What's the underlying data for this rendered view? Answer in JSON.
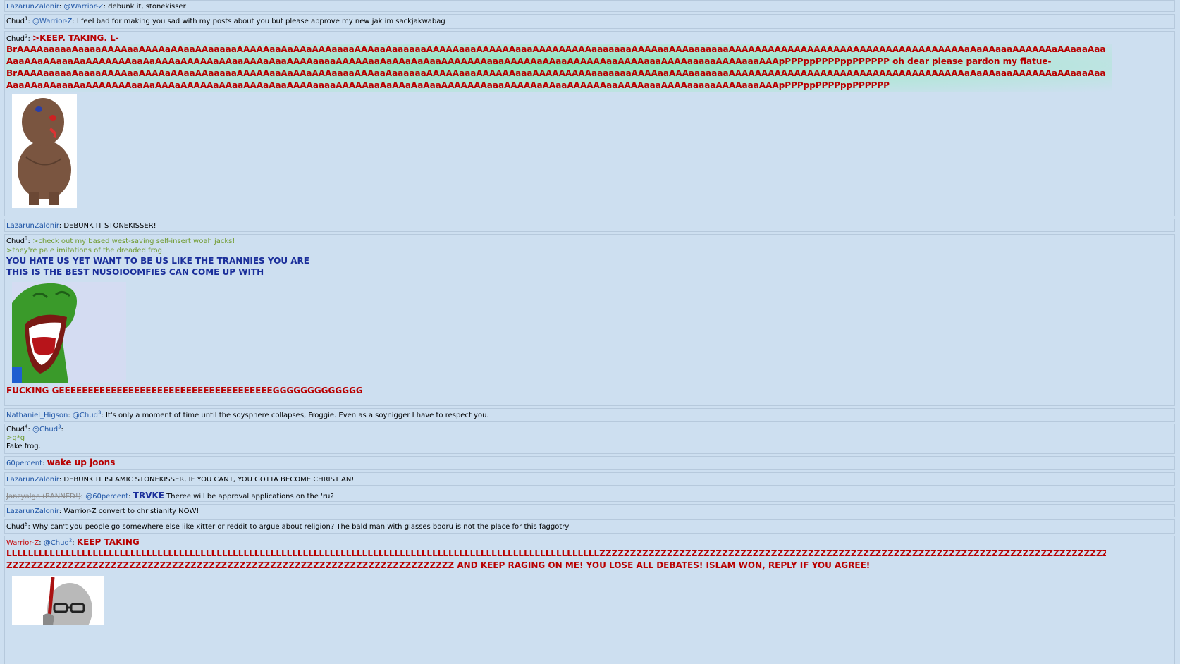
{
  "messages": [
    {
      "user": "LazarunZalonir",
      "mention": "@Warrior-Z",
      "text": ": debunk it, stonekisser"
    },
    {
      "user": "Chud",
      "sup": "1",
      "mention": "@Warrior-Z",
      "text": ": I feel bad for making you sad with my posts about you but please approve my new jak im sackjakwabag"
    },
    {
      "user": "Chud",
      "sup": "2",
      "big_line1": ">KEEP. TAKING. L-",
      "big_line2": "BrAAAAaaaaaAaaaaAAAAaaAAAAaAAaaAAaaaaaAAAAAaaAaAAaAAAaaaaAAAaaAaaaaaaAAAAAaaaAAAAAAaaaAAAAAAAAAaaaaaaaAAAAaaAAAaaaaaaaAAAAAAAAAAAAAAAAAAAAAAAAAAAAAAAAAAAAaAaAAaaaAAAAAAaAAaaaAaaaaaaaAaAAAaaaAAA",
      "big_line3": "AaaAAaAAaaaAaAAAAAAAaaAaAAAaAAAAAaAAaaAAAaAaaAAAAaaaaAAAAAaaAaAAaAaAaaAAAAAAAaaaAAAAAaAAaaAAAAAAaaAAAAaaaAAAAaaaaaAAAAaaaAAApPPPppPPPPppPPPPPP",
      "big_line3_tail": " oh dear please pardon my flatue-",
      "big_line4": "BrAAAAaaaaaAaaaaAAAAaaAAAAaAAaaAAaaaaaAAAAAaaAaAAaAAAaaaaAAAaaAaaaaaaAAAAAaaaAAAAAAaaaAAAAAAAAAaaaaaaaAAAAaaAAAaaaaaaaAAAAAAAAAAAAAAAAAAAAAAAAAAAAAAAAAAAAaAaAAaaaAAAAAAaAAaaaAaaaaaaaAaAAAaaaAAA",
      "big_line5": "AaaAAaAAaaaAaAAAAAAAaaAaAAAaAAAAAaAAaaAAAaAaaAAAAaaaaAAAAAaaAaAAaAaAaaAAAAAAAaaaAAAAAaAAaaAAAAAAaaAAAAaaaAAAAaaaaaAAAAaaaAAApPPPppPPPPppPPPPPP"
    },
    {
      "user": "LazarunZalonir",
      "text": ": DEBUNK IT STONEKISSER!"
    },
    {
      "user": "Chud",
      "sup": "3",
      "green1": ">check out my based west-saving self-insert woah jacks!",
      "green2": ">they're pale imitations of the dreaded frog",
      "blue1": "YOU HATE US YET WANT TO BE US LIKE THE TRANNIES YOU ARE",
      "blue2": "THIS IS THE BEST NUSOIOOMFIES CAN COME UP WITH",
      "red_after": "FUCKING GEEEEEEEEEEEEEEEEEEEEEEEEEEEEEEEEEEEEEGGGGGGGGGGGGG"
    },
    {
      "user": "Nathaniel_Higson",
      "mention": "@Chud",
      "mention_sup": "3",
      "text": ": It's only a moment of time until the soysphere collapses, Froggie. Even as a soynigger I have to respect you."
    },
    {
      "user": "Chud",
      "sup": "4",
      "mention": "@Chud",
      "mention_sup": "3",
      "text": ":",
      "green": ">g*g",
      "text2": "Fake frog."
    },
    {
      "user": "60percent",
      "text": ": ",
      "bigred": "wake up joons"
    },
    {
      "user": "LazarunZalonir",
      "text": ": DEBUNK IT ISLAMIC STONEKISSER, IF YOU CANT, YOU GOTTA BECOME CHRISTIAN!"
    },
    {
      "user": "Janzyalgo (BANNED!)",
      "mention": "@60percent",
      "text": ": ",
      "bigblue": "TRVKE",
      "text2": " Theree will be approval applications on the 'ru?"
    },
    {
      "user": "LazarunZalonir",
      "text": ": Warrior-Z convert to christianity NOW!"
    },
    {
      "user": "Chud",
      "sup": "5",
      "text": ": Why can't you people go somewhere else like xitter or reddit to argue about religion? The bald man with glasses booru is not the place for this faggotry"
    },
    {
      "user": "Warrior-Z",
      "mention": "@Chud",
      "mention_sup": "2",
      "text": ": ",
      "big1": "KEEP TAKING",
      "big2": "LLLLLLLLLLLLLLLLLLLLLLLLLLLLLLLLLLLLLLLLLLLLLLLLLLLLLLLLLLLLLLLLLLLLLLLLLLLLLLLLLLLLLLLLLLLLLLLLLLLLLLLLLLLLLLZZZZZZZZZZZZZZZZZZZZZZZZZZZZZZZZZZZZZZZZZZZZZZZZZZZZZZZZZZZZZZZZZZZZZZZZZZZZZZZZZZZZZZZZZZZZZZZZZZZZZ",
      "big3": "ZZZZZZZZZZZZZZZZZZZZZZZZZZZZZZZZZZZZZZZZZZZZZZZZZZZZZZZZZZZZZZZZZZZZZZZZZ AND KEEP RAGING ON ME! YOU LOSE ALL DEBATES! ISLAM WON, REPLY IF YOU AGREE!"
    }
  ],
  "colors": {
    "background": "#cddff0",
    "username": "#1f55a6",
    "red": "#b80000",
    "blue": "#1a2e9a",
    "green": "#6f9a2e"
  }
}
